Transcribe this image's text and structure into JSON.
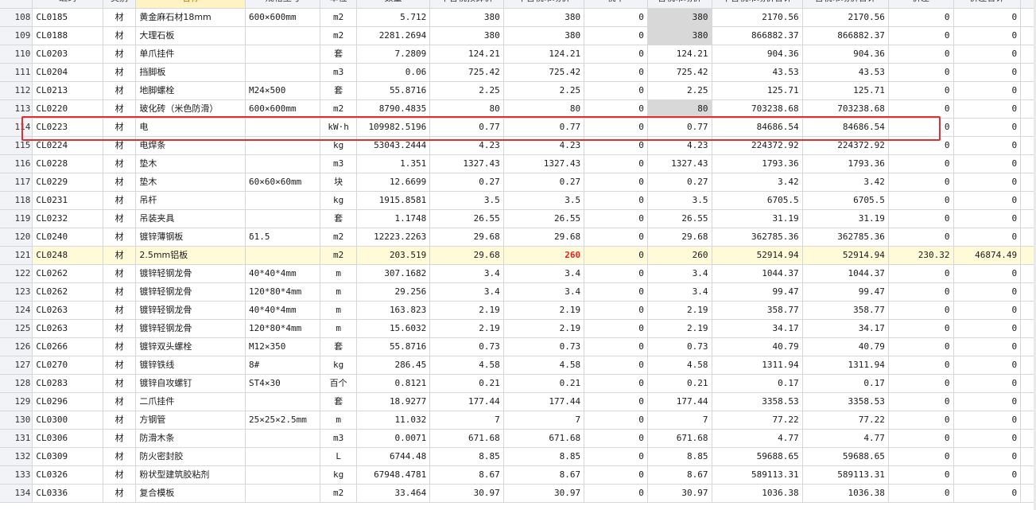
{
  "headers": [
    "",
    "编码",
    "类别",
    "名称",
    "规格型号",
    "单位",
    "数量",
    "不含税预算价",
    "不含税市场价",
    "税率",
    "含税市场价",
    "不含税市场价合计",
    "含税市场价合计",
    "价差",
    "价差合计",
    ""
  ],
  "rows": [
    {
      "idx": "108",
      "code": "CL0185",
      "type": "材",
      "name": "黄金麻石材18mm",
      "spec": "600×600mm",
      "unit": "m2",
      "qty": "5.712",
      "budget": "380",
      "market": "380",
      "tax": "0",
      "taxmarket": "380",
      "total": "2170.56",
      "taxtotal": "2170.56",
      "diff": "0",
      "difftotal": "0",
      "gray": true
    },
    {
      "idx": "109",
      "code": "CL0188",
      "type": "材",
      "name": "大理石板",
      "spec": "",
      "unit": "m2",
      "qty": "2281.2694",
      "budget": "380",
      "market": "380",
      "tax": "0",
      "taxmarket": "380",
      "total": "866882.37",
      "taxtotal": "866882.37",
      "diff": "0",
      "difftotal": "0",
      "gray": true
    },
    {
      "idx": "110",
      "code": "CL0203",
      "type": "材",
      "name": "单爪挂件",
      "spec": "",
      "unit": "套",
      "qty": "7.2809",
      "budget": "124.21",
      "market": "124.21",
      "tax": "0",
      "taxmarket": "124.21",
      "total": "904.36",
      "taxtotal": "904.36",
      "diff": "0",
      "difftotal": "0"
    },
    {
      "idx": "111",
      "code": "CL0204",
      "type": "材",
      "name": "挡脚板",
      "spec": "",
      "unit": "m3",
      "qty": "0.06",
      "budget": "725.42",
      "market": "725.42",
      "tax": "0",
      "taxmarket": "725.42",
      "total": "43.53",
      "taxtotal": "43.53",
      "diff": "0",
      "difftotal": "0"
    },
    {
      "idx": "112",
      "code": "CL0213",
      "type": "材",
      "name": "地脚螺栓",
      "spec": "M24×500",
      "unit": "套",
      "qty": "55.8716",
      "budget": "2.25",
      "market": "2.25",
      "tax": "0",
      "taxmarket": "2.25",
      "total": "125.71",
      "taxtotal": "125.71",
      "diff": "0",
      "difftotal": "0"
    },
    {
      "idx": "113",
      "code": "CL0220",
      "type": "材",
      "name": "玻化砖（米色防滑）",
      "spec": "600×600mm",
      "unit": "m2",
      "qty": "8790.4835",
      "budget": "80",
      "market": "80",
      "tax": "0",
      "taxmarket": "80",
      "total": "703238.68",
      "taxtotal": "703238.68",
      "diff": "0",
      "difftotal": "0",
      "gray": true
    },
    {
      "idx": "114",
      "code": "CL0223",
      "type": "材",
      "name": "电",
      "spec": "",
      "unit": "kW·h",
      "qty": "109982.5196",
      "budget": "0.77",
      "market": "0.77",
      "tax": "0",
      "taxmarket": "0.77",
      "total": "84686.54",
      "taxtotal": "84686.54",
      "diff": "0",
      "difftotal": "0"
    },
    {
      "idx": "115",
      "code": "CL0224",
      "type": "材",
      "name": "电焊条",
      "spec": "",
      "unit": "kg",
      "qty": "53043.2444",
      "budget": "4.23",
      "market": "4.23",
      "tax": "0",
      "taxmarket": "4.23",
      "total": "224372.92",
      "taxtotal": "224372.92",
      "diff": "0",
      "difftotal": "0"
    },
    {
      "idx": "116",
      "code": "CL0228",
      "type": "材",
      "name": "垫木",
      "spec": "",
      "unit": "m3",
      "qty": "1.351",
      "budget": "1327.43",
      "market": "1327.43",
      "tax": "0",
      "taxmarket": "1327.43",
      "total": "1793.36",
      "taxtotal": "1793.36",
      "diff": "0",
      "difftotal": "0"
    },
    {
      "idx": "117",
      "code": "CL0229",
      "type": "材",
      "name": "垫木",
      "spec": "60×60×60mm",
      "unit": "块",
      "qty": "12.6699",
      "budget": "0.27",
      "market": "0.27",
      "tax": "0",
      "taxmarket": "0.27",
      "total": "3.42",
      "taxtotal": "3.42",
      "diff": "0",
      "difftotal": "0"
    },
    {
      "idx": "118",
      "code": "CL0231",
      "type": "材",
      "name": "吊杆",
      "spec": "",
      "unit": "kg",
      "qty": "1915.8581",
      "budget": "3.5",
      "market": "3.5",
      "tax": "0",
      "taxmarket": "3.5",
      "total": "6705.5",
      "taxtotal": "6705.5",
      "diff": "0",
      "difftotal": "0"
    },
    {
      "idx": "119",
      "code": "CL0232",
      "type": "材",
      "name": "吊装夹具",
      "spec": "",
      "unit": "套",
      "qty": "1.1748",
      "budget": "26.55",
      "market": "26.55",
      "tax": "0",
      "taxmarket": "26.55",
      "total": "31.19",
      "taxtotal": "31.19",
      "diff": "0",
      "difftotal": "0"
    },
    {
      "idx": "120",
      "code": "CL0240",
      "type": "材",
      "name": "镀锌薄钢板",
      "spec": "δ1.5",
      "unit": "m2",
      "qty": "12223.2263",
      "budget": "29.68",
      "market": "29.68",
      "tax": "0",
      "taxmarket": "29.68",
      "total": "362785.36",
      "taxtotal": "362785.36",
      "diff": "0",
      "difftotal": "0"
    },
    {
      "idx": "121",
      "code": "CL0248",
      "type": "材",
      "name": "2.5mm铝板",
      "spec": "",
      "unit": "m2",
      "qty": "203.519",
      "budget": "29.68",
      "market": "260",
      "tax": "0",
      "taxmarket": "260",
      "total": "52914.94",
      "taxtotal": "52914.94",
      "diff": "230.32",
      "difftotal": "46874.49",
      "selected": true,
      "redMarket": true
    },
    {
      "idx": "122",
      "code": "CL0262",
      "type": "材",
      "name": "镀锌轻钢龙骨",
      "spec": "40*40*4mm",
      "unit": "m",
      "qty": "307.1682",
      "budget": "3.4",
      "market": "3.4",
      "tax": "0",
      "taxmarket": "3.4",
      "total": "1044.37",
      "taxtotal": "1044.37",
      "diff": "0",
      "difftotal": "0"
    },
    {
      "idx": "123",
      "code": "CL0262",
      "type": "材",
      "name": "镀锌轻钢龙骨",
      "spec": "120*80*4mm",
      "unit": "m",
      "qty": "29.256",
      "budget": "3.4",
      "market": "3.4",
      "tax": "0",
      "taxmarket": "3.4",
      "total": "99.47",
      "taxtotal": "99.47",
      "diff": "0",
      "difftotal": "0"
    },
    {
      "idx": "124",
      "code": "CL0263",
      "type": "材",
      "name": "镀锌轻钢龙骨",
      "spec": "40*40*4mm",
      "unit": "m",
      "qty": "163.823",
      "budget": "2.19",
      "market": "2.19",
      "tax": "0",
      "taxmarket": "2.19",
      "total": "358.77",
      "taxtotal": "358.77",
      "diff": "0",
      "difftotal": "0"
    },
    {
      "idx": "125",
      "code": "CL0263",
      "type": "材",
      "name": "镀锌轻钢龙骨",
      "spec": "120*80*4mm",
      "unit": "m",
      "qty": "15.6032",
      "budget": "2.19",
      "market": "2.19",
      "tax": "0",
      "taxmarket": "2.19",
      "total": "34.17",
      "taxtotal": "34.17",
      "diff": "0",
      "difftotal": "0"
    },
    {
      "idx": "126",
      "code": "CL0266",
      "type": "材",
      "name": "镀锌双头螺栓",
      "spec": "M12×350",
      "unit": "套",
      "qty": "55.8716",
      "budget": "0.73",
      "market": "0.73",
      "tax": "0",
      "taxmarket": "0.73",
      "total": "40.79",
      "taxtotal": "40.79",
      "diff": "0",
      "difftotal": "0"
    },
    {
      "idx": "127",
      "code": "CL0270",
      "type": "材",
      "name": "镀锌铁线",
      "spec": "8#",
      "unit": "kg",
      "qty": "286.45",
      "budget": "4.58",
      "market": "4.58",
      "tax": "0",
      "taxmarket": "4.58",
      "total": "1311.94",
      "taxtotal": "1311.94",
      "diff": "0",
      "difftotal": "0"
    },
    {
      "idx": "128",
      "code": "CL0283",
      "type": "材",
      "name": "镀锌自攻螺钉",
      "spec": "ST4×30",
      "unit": "百个",
      "qty": "0.8121",
      "budget": "0.21",
      "market": "0.21",
      "tax": "0",
      "taxmarket": "0.21",
      "total": "0.17",
      "taxtotal": "0.17",
      "diff": "0",
      "difftotal": "0"
    },
    {
      "idx": "129",
      "code": "CL0296",
      "type": "材",
      "name": "二爪挂件",
      "spec": "",
      "unit": "套",
      "qty": "18.9277",
      "budget": "177.44",
      "market": "177.44",
      "tax": "0",
      "taxmarket": "177.44",
      "total": "3358.53",
      "taxtotal": "3358.53",
      "diff": "0",
      "difftotal": "0"
    },
    {
      "idx": "130",
      "code": "CL0300",
      "type": "材",
      "name": "方钢管",
      "spec": "25×25×2.5mm",
      "unit": "m",
      "qty": "11.032",
      "budget": "7",
      "market": "7",
      "tax": "0",
      "taxmarket": "7",
      "total": "77.22",
      "taxtotal": "77.22",
      "diff": "0",
      "difftotal": "0"
    },
    {
      "idx": "131",
      "code": "CL0306",
      "type": "材",
      "name": "防滑木条",
      "spec": "",
      "unit": "m3",
      "qty": "0.0071",
      "budget": "671.68",
      "market": "671.68",
      "tax": "0",
      "taxmarket": "671.68",
      "total": "4.77",
      "taxtotal": "4.77",
      "diff": "0",
      "difftotal": "0"
    },
    {
      "idx": "132",
      "code": "CL0309",
      "type": "材",
      "name": "防火密封胶",
      "spec": "",
      "unit": "L",
      "qty": "6744.48",
      "budget": "8.85",
      "market": "8.85",
      "tax": "0",
      "taxmarket": "8.85",
      "total": "59688.65",
      "taxtotal": "59688.65",
      "diff": "0",
      "difftotal": "0"
    },
    {
      "idx": "133",
      "code": "CL0326",
      "type": "材",
      "name": "粉状型建筑胶粘剂",
      "spec": "",
      "unit": "kg",
      "qty": "67948.4781",
      "budget": "8.67",
      "market": "8.67",
      "tax": "0",
      "taxmarket": "8.67",
      "total": "589113.31",
      "taxtotal": "589113.31",
      "diff": "0",
      "difftotal": "0"
    },
    {
      "idx": "134",
      "code": "CL0336",
      "type": "材",
      "name": "复合模板",
      "spec": "",
      "unit": "m2",
      "qty": "33.464",
      "budget": "30.97",
      "market": "30.97",
      "tax": "0",
      "taxmarket": "30.97",
      "total": "1036.38",
      "taxtotal": "1036.38",
      "diff": "0",
      "difftotal": "0"
    }
  ],
  "colors": {
    "highlight": "#e02f2f",
    "selected_row": "#fffbd9",
    "red_value": "#e02020",
    "gray_cell": "#d8d8d8"
  }
}
